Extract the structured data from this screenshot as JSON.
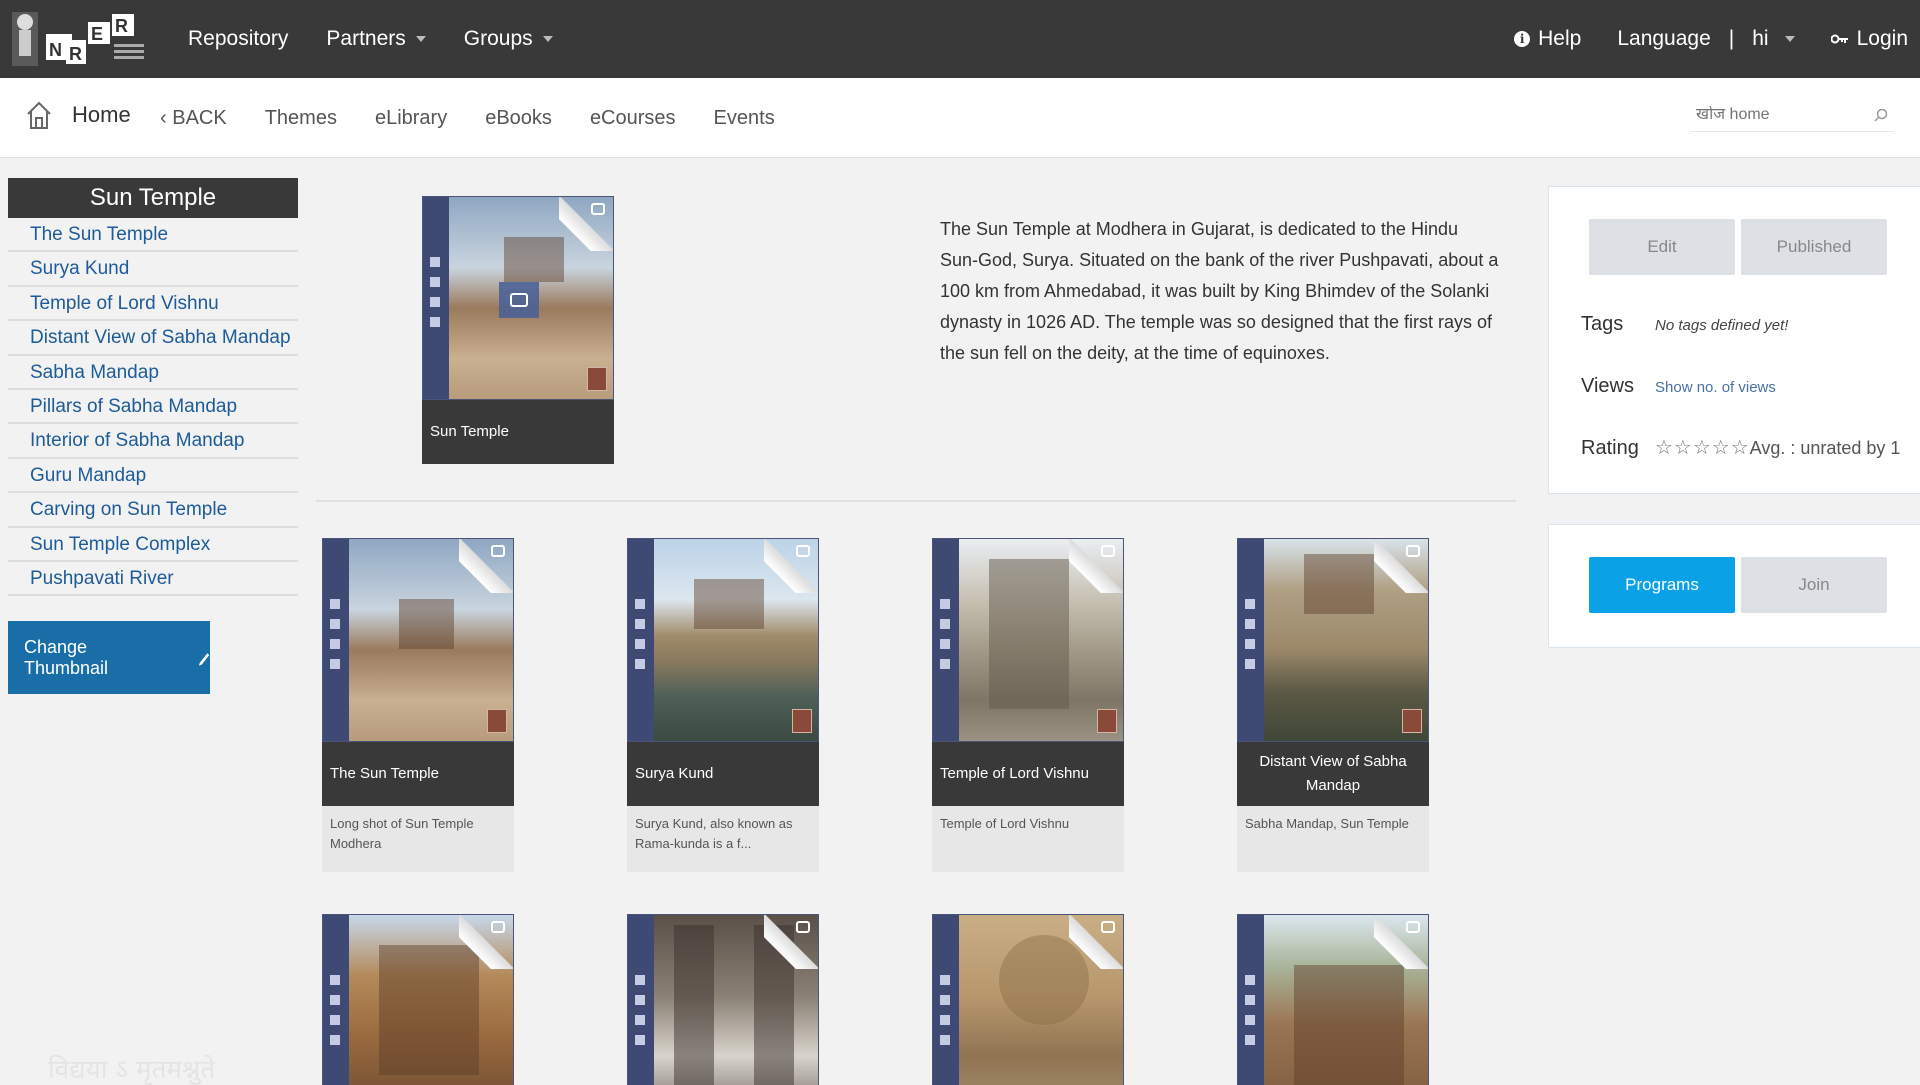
{
  "topbar": {
    "nav": [
      "Repository",
      "Partners",
      "Groups"
    ],
    "help": "Help",
    "language": "Language",
    "separator": "|",
    "lang_value": "hi",
    "login": "Login"
  },
  "subnav": {
    "home": "Home",
    "back": "BACK",
    "links": [
      "Themes",
      "eLibrary",
      "eBooks",
      "eCourses",
      "Events"
    ],
    "search_placeholder": "खोज home"
  },
  "sidebar": {
    "title": "Sun Temple",
    "items": [
      "The Sun Temple",
      "Surya Kund",
      "Temple of Lord Vishnu",
      "Distant View of Sabha Mandap",
      "Sabha Mandap",
      "Pillars of Sabha Mandap",
      "Interior of Sabha Mandap",
      "Guru Mandap",
      "Carving on Sun Temple",
      "Sun Temple Complex",
      "Pushpavati River"
    ],
    "change_thumbnail": "Change Thumbnail",
    "watermark": "विद्यया ऽ मृतमश्नुते"
  },
  "main": {
    "card_title": "Sun Temple",
    "description": "The Sun Temple at Modhera in Gujarat, is dedicated to the Hindu Sun-God, Surya. Situated on the bank of the river Pushpavati, about a 100 km from Ahmedabad, it was built by King Bhimdev of the Solanki dynasty in 1026 AD. The temple was so designed that the first rays of the sun fell on the deity, at the time of equinoxes.",
    "tiles": [
      {
        "title": "The Sun Temple",
        "caption": "Long shot of Sun Temple Modhera"
      },
      {
        "title": "Surya Kund",
        "caption": "Surya Kund, also known as Rama-kunda is a f..."
      },
      {
        "title": "Temple of Lord Vishnu",
        "caption": "Temple of Lord Vishnu"
      },
      {
        "title": "Distant View of Sabha Mandap",
        "caption": "Sabha Mandap, Sun Temple"
      }
    ]
  },
  "panel": {
    "edit": "Edit",
    "published": "Published",
    "tags_label": "Tags",
    "tags_value": "No tags defined yet!",
    "views_label": "Views",
    "views_value": "Show no. of views",
    "rating_label": "Rating",
    "rating_stars": "☆☆☆☆☆",
    "rating_text": "Avg. :  unrated by 1",
    "programs": "Programs",
    "join": "Join"
  },
  "colors": {
    "topbar": "#393939",
    "link": "#1e5b99",
    "programs": "#0aa1e6",
    "change_thumb": "#1a6ea8"
  }
}
